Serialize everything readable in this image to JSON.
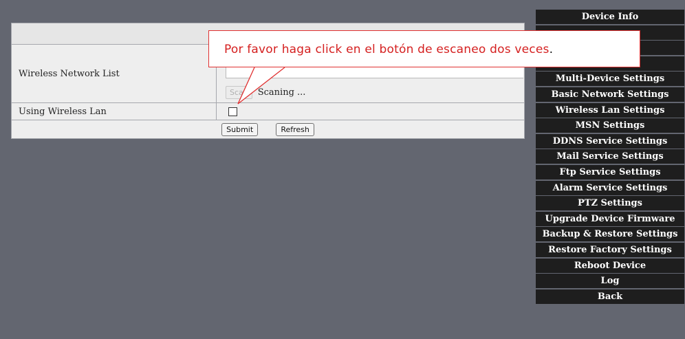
{
  "panel": {
    "header": "",
    "wireless_list_label": "Wireless Network List",
    "scan_button": "Scan",
    "scan_status": "Scaning ...",
    "using_wireless_label": "Using Wireless Lan",
    "using_wireless_checked": false,
    "submit_button": "Submit",
    "refresh_button": "Refresh"
  },
  "menu": {
    "items": [
      {
        "label": "Device Info"
      },
      {
        "label": ""
      },
      {
        "label": ""
      },
      {
        "label": ""
      },
      {
        "label": "Multi-Device Settings"
      },
      {
        "label": "Basic Network Settings"
      },
      {
        "label": "Wireless Lan Settings"
      },
      {
        "label": "MSN Settings"
      },
      {
        "label": "DDNS Service Settings"
      },
      {
        "label": "Mail Service Settings"
      },
      {
        "label": "Ftp Service Settings"
      },
      {
        "label": "Alarm Service Settings"
      },
      {
        "label": "PTZ Settings"
      },
      {
        "label": "Upgrade Device Firmware"
      },
      {
        "label": "Backup & Restore Settings"
      },
      {
        "label": "Restore Factory Settings"
      },
      {
        "label": "Reboot Device"
      },
      {
        "label": "Log"
      },
      {
        "label": "Back"
      }
    ]
  },
  "callout": {
    "text": "Por favor haga click en el botón de escaneo dos veces",
    "period": "."
  },
  "colors": {
    "background": "#636670",
    "menu_bg": "#1e1e1e",
    "callout_border": "#e03030",
    "callout_text": "#d52020"
  }
}
